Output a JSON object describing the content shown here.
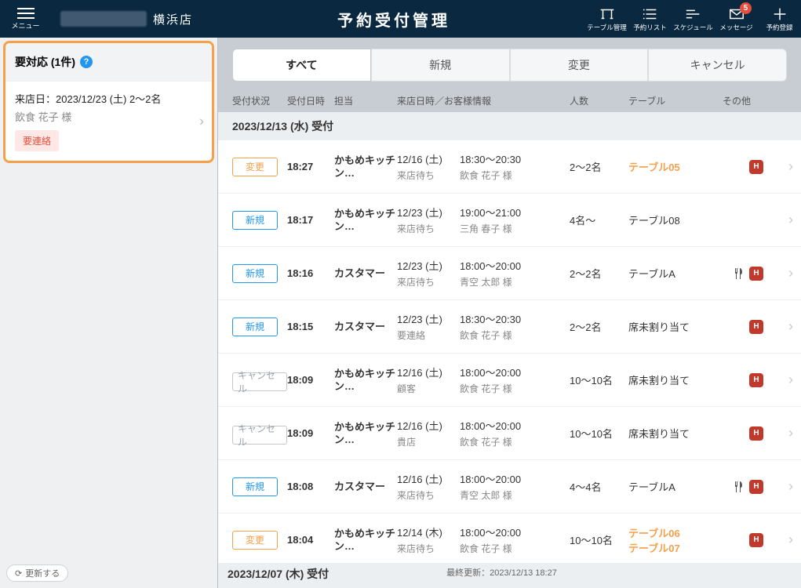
{
  "header": {
    "menu_label": "メニュー",
    "store_name": "横浜店",
    "title": "予約受付管理",
    "icons": {
      "table": "テーブル管理",
      "list": "予約リスト",
      "schedule": "スケジュール",
      "message": "メッセージ",
      "add": "予約登録"
    },
    "message_badge": "5"
  },
  "sidebar": {
    "alert_title": "要対応 (1件)",
    "item": {
      "line1": "来店日：2023/12/23 (土) 2〜2名",
      "line2": "飲食 花子 様",
      "tag": "要連絡"
    },
    "refresh": "更新する"
  },
  "tabs": [
    "すべて",
    "新規",
    "変更",
    "キャンセル"
  ],
  "columns": {
    "status": "受付状況",
    "time": "受付日時",
    "staff": "担当",
    "visit": "来店日時／お客様情報",
    "party": "人数",
    "table": "テーブル",
    "other": "その他"
  },
  "groups": [
    {
      "label": "2023/12/13 (水) 受付"
    },
    {
      "label": "2023/12/07 (木) 受付"
    }
  ],
  "last_updated_label": "最終更新：",
  "last_updated": "2023/12/13 18:27",
  "rows": [
    {
      "status": "変更",
      "status_cls": "st-change",
      "time": "18:27",
      "staff": "かもめキッチン…",
      "visit_date": "12/16 (土)",
      "visit_sub": "来店待ち",
      "range": "18:30〜20:30",
      "guest": "飲食 花子 様",
      "party": "2〜2名",
      "table": "テーブル05",
      "table_hl": true,
      "ico_cut": false,
      "ico_h": true
    },
    {
      "status": "新規",
      "status_cls": "st-new",
      "time": "18:17",
      "staff": "かもめキッチン…",
      "visit_date": "12/23 (土)",
      "visit_sub": "来店待ち",
      "range": "19:00〜21:00",
      "guest": "三角 春子 様",
      "party": "4名〜",
      "table": "テーブル08",
      "table_hl": false,
      "ico_cut": false,
      "ico_h": false
    },
    {
      "status": "新規",
      "status_cls": "st-new",
      "time": "18:16",
      "staff": "カスタマー",
      "visit_date": "12/23 (土)",
      "visit_sub": "来店待ち",
      "range": "18:00〜20:00",
      "guest": "青空 太郎 様",
      "party": "2〜2名",
      "table": "テーブルA",
      "table_hl": false,
      "ico_cut": true,
      "ico_h": true
    },
    {
      "status": "新規",
      "status_cls": "st-new",
      "time": "18:15",
      "staff": "カスタマー",
      "visit_date": "12/23 (土)",
      "visit_sub": "要連絡",
      "range": "18:30〜20:30",
      "guest": "飲食 花子 様",
      "party": "2〜2名",
      "table": "席未割り当て",
      "table_hl": false,
      "ico_cut": false,
      "ico_h": true
    },
    {
      "status": "キャンセル",
      "status_cls": "st-cancel",
      "time": "18:09",
      "staff": "かもめキッチン…",
      "visit_date": "12/16 (土)",
      "visit_sub": "顧客",
      "range": "18:00〜20:00",
      "guest": "飲食 花子 様",
      "party": "10〜10名",
      "table": "席未割り当て",
      "table_hl": false,
      "ico_cut": false,
      "ico_h": true
    },
    {
      "status": "キャンセル",
      "status_cls": "st-cancel",
      "time": "18:09",
      "staff": "かもめキッチン…",
      "visit_date": "12/16 (土)",
      "visit_sub": "貴店",
      "range": "18:00〜20:00",
      "guest": "飲食 花子 様",
      "party": "10〜10名",
      "table": "席未割り当て",
      "table_hl": false,
      "ico_cut": false,
      "ico_h": true
    },
    {
      "status": "新規",
      "status_cls": "st-new",
      "time": "18:08",
      "staff": "カスタマー",
      "visit_date": "12/16 (土)",
      "visit_sub": "来店待ち",
      "range": "18:00〜20:00",
      "guest": "青空 太郎 様",
      "party": "4〜4名",
      "table": "テーブルA",
      "table_hl": false,
      "ico_cut": true,
      "ico_h": true
    },
    {
      "status": "変更",
      "status_cls": "st-change",
      "time": "18:04",
      "staff": "かもめキッチン…",
      "visit_date": "12/14 (木)",
      "visit_sub": "来店待ち",
      "range": "18:00〜20:00",
      "guest": "飲食 花子 様",
      "party": "10〜10名",
      "table": "テーブル06\nテーブル07",
      "table_hl": true,
      "ico_cut": false,
      "ico_h": true
    }
  ]
}
